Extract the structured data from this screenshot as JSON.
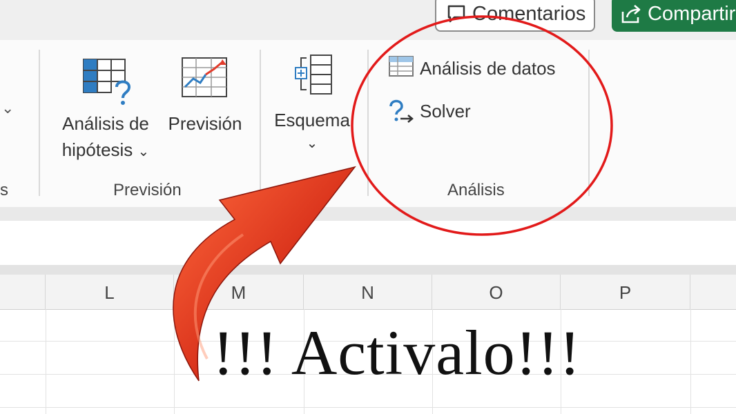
{
  "topbar": {
    "comments_label": "Comentarios",
    "share_label": "Compartir"
  },
  "ribbon": {
    "whatif_label_1": "Análisis de",
    "whatif_label_2": "hipótesis",
    "forecast_label": "Previsión",
    "forecast_group_label": "Previsión",
    "outline_label": "Esquema",
    "data_analysis_label": "Análisis de datos",
    "solver_label": "Solver",
    "analysis_group_label": "Análisis",
    "partial_group_label": "s"
  },
  "columns": [
    "L",
    "M",
    "N",
    "O",
    "P"
  ],
  "overlay": {
    "caption": "!!! Activalo!!!",
    "highlight_color": "#e21a1a",
    "arrow_color": "#d9321b"
  },
  "colors": {
    "share_green": "#1e7a45",
    "icon_blue": "#2f7dc2"
  }
}
